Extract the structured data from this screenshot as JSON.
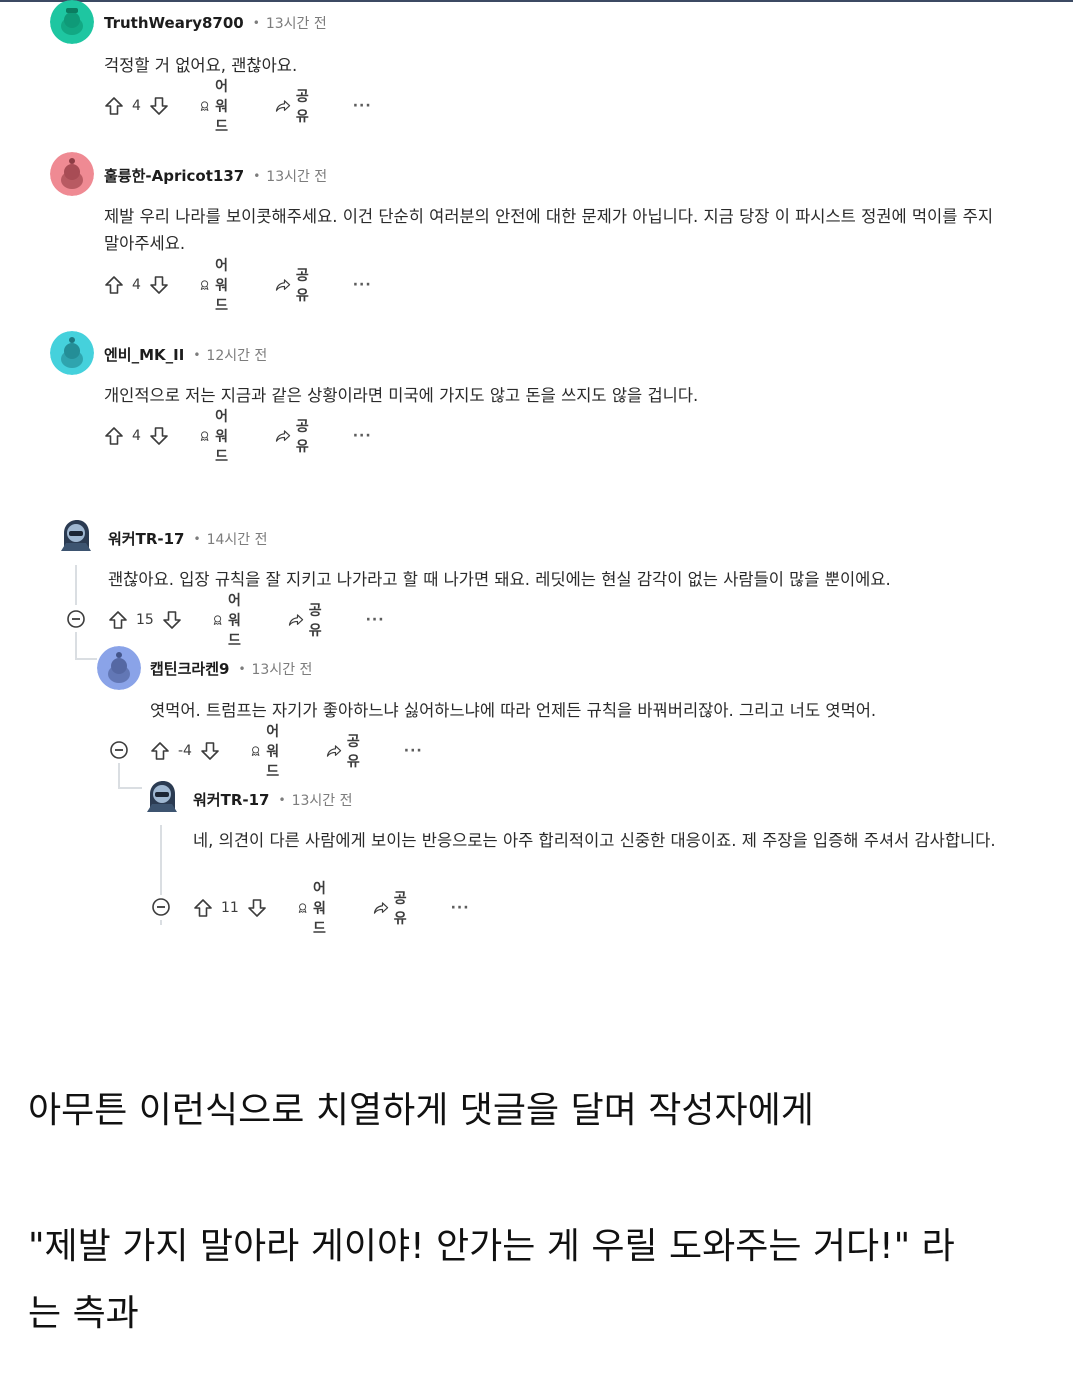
{
  "comments": [
    {
      "username": "TruthWeary8700",
      "time": "13시간 전",
      "text": "걱정할 거 없어요, 괜찮아요.",
      "score": "4",
      "award_label": "어워드",
      "share_label": "공유",
      "avatar_color": "#1ec6a1"
    },
    {
      "username": "훌륭한-Apricot137",
      "time": "13시간 전",
      "text": "제발 우리 나라를 보이콧해주세요. 이건 단순히 여러분의 안전에 대한 문제가 아닙니다. 지금 당장 이 파시스트 정권에 먹이를 주지 말아주세요.",
      "score": "4",
      "award_label": "어워드",
      "share_label": "공유",
      "avatar_color": "#ef8a93"
    },
    {
      "username": "엔비_MK_II",
      "time": "12시간 전",
      "text": "개인적으로 저는 지금과 같은 상황이라면 미국에 가지도 않고 돈을 쓰지도 않을 겁니다.",
      "score": "4",
      "award_label": "어워드",
      "share_label": "공유",
      "avatar_color": "#45d1dc"
    },
    {
      "username": "워커TR-17",
      "time": "14시간 전",
      "text": "괜찮아요. 입장 규칙을 잘 지키고 나가라고 할 때 나가면 돼요. 레딧에는 현실 감각이 없는 사람들이 많을 뿐이에요.",
      "score": "15",
      "award_label": "어워드",
      "share_label": "공유"
    },
    {
      "username": "캡틴크라켄9",
      "time": "13시간 전",
      "text": "엿먹어. 트럼프는 자기가 좋아하느냐 싫어하느냐에 따라 언제든 규칙을 바꿔버리잖아. 그리고 너도 엿먹어.",
      "score": "-4",
      "award_label": "어워드",
      "share_label": "공유",
      "avatar_color": "#8aa3e8"
    },
    {
      "username": "워커TR-17",
      "time": "13시간 전",
      "text": "네, 의견이 다른 사람에게 보이는 반응으로는 아주 합리적이고 신중한 대응이죠. 제 주장을 입증해 주셔서 감사합니다.",
      "score": "11",
      "award_label": "어워드",
      "share_label": "공유"
    }
  ],
  "more_label": "···",
  "caption": {
    "line1": "아무튼 이런식으로 치열하게 댓글을 달며 작성자에게",
    "line2": "\"제발 가지 말아라 게이야! 안가는 게 우릴 도와주는 거다!\" 라",
    "line3": "는 측과"
  },
  "colors": {
    "text": "#1c1c1c",
    "meta": "#7c7c7c",
    "thread_line": "#dadee2",
    "top_border": "#3c4a63"
  }
}
